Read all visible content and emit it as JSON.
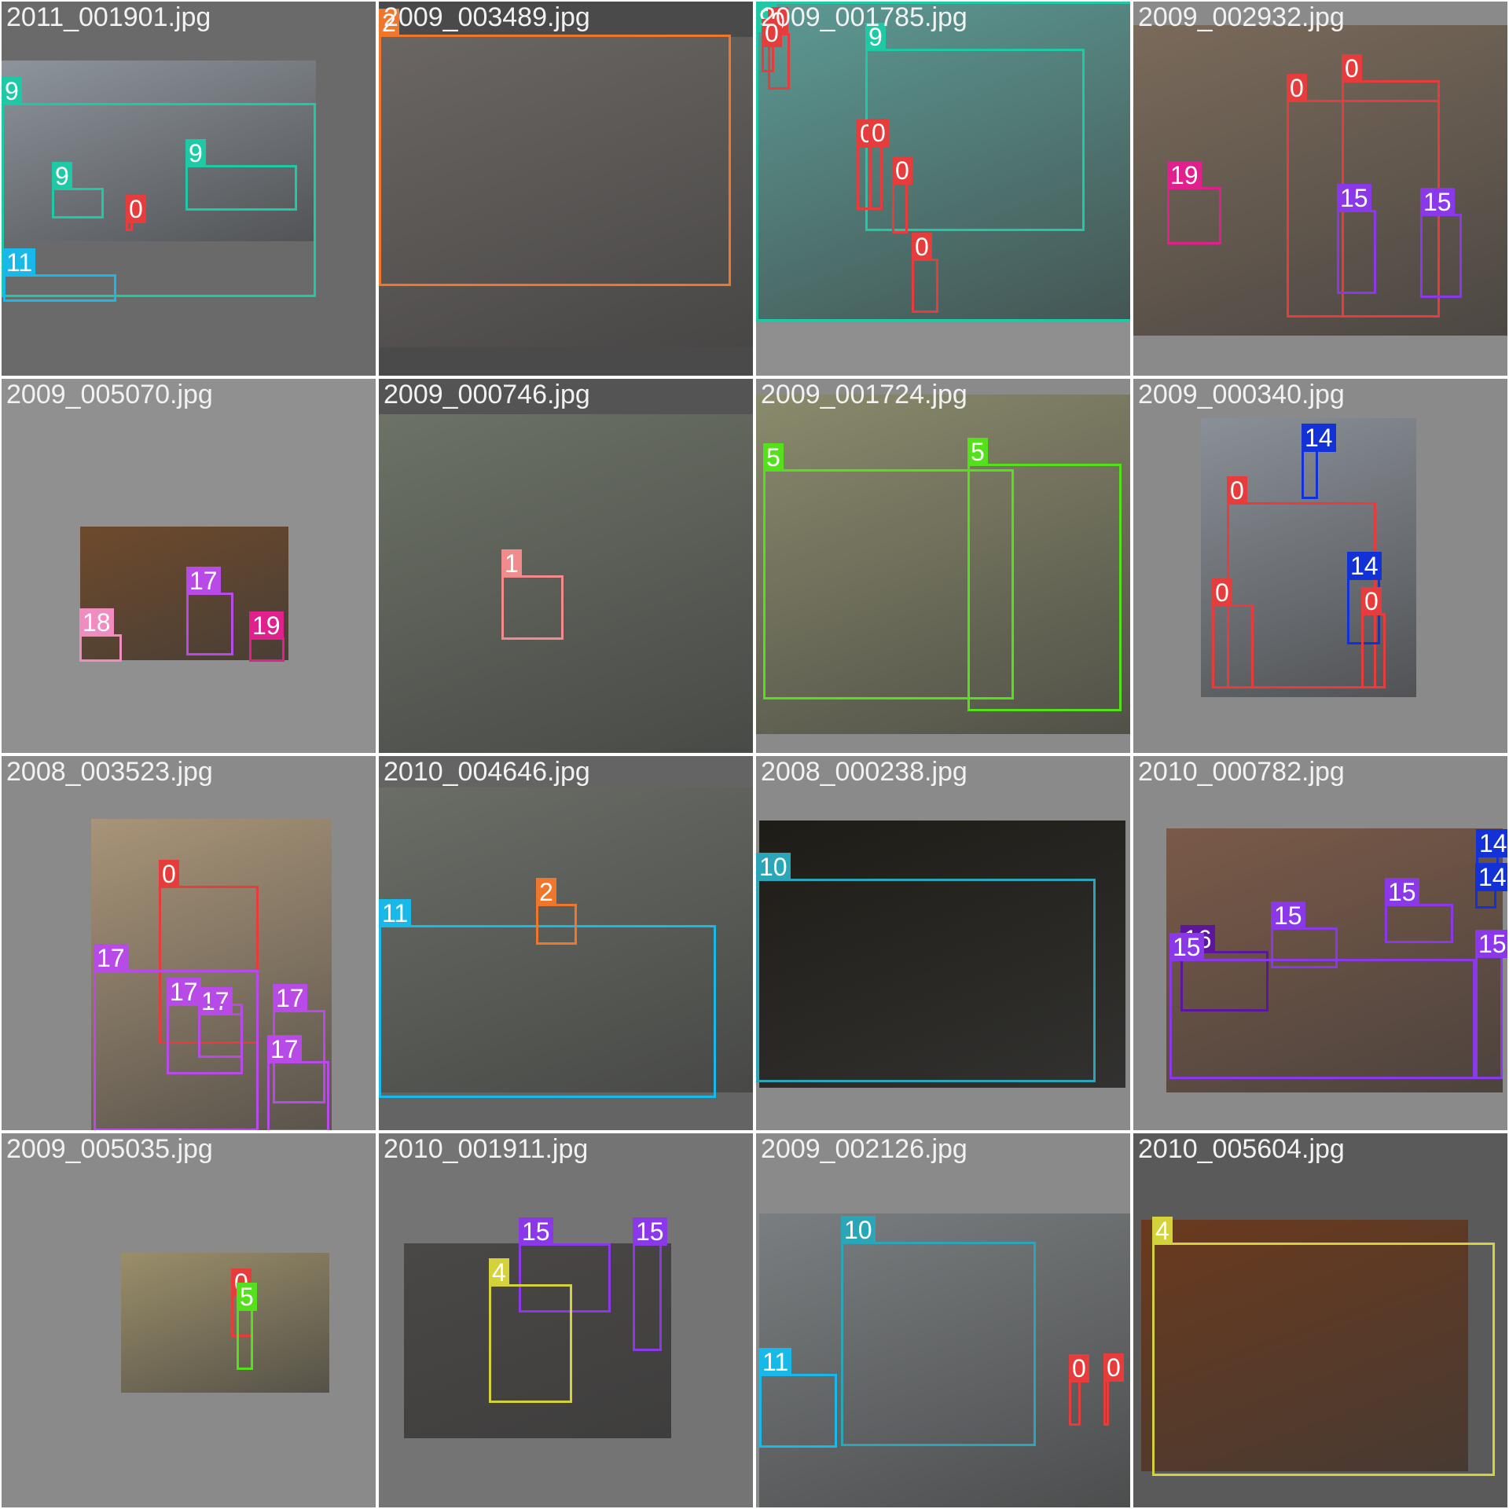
{
  "grid": {
    "rows": 4,
    "cols": 4
  },
  "class_colors": {
    "0": "#e63c3c",
    "1": "#f28b8b",
    "2": "#f0762b",
    "4": "#d4d23a",
    "5": "#55e01c",
    "9": "#1fc9a6",
    "10": "#2aa6b8",
    "11": "#18b8e8",
    "14": "#1232d8",
    "15": "#8a38e8",
    "16": "#5c169c",
    "17": "#b84ae8",
    "18": "#f08cc0",
    "19": "#e0208c"
  },
  "tiles": [
    {
      "filename": "2011_001901.jpg",
      "bg": "#6a6a6a",
      "photo": "#8d949c",
      "boxes": [
        {
          "label": "9"
        },
        {
          "label": "9"
        },
        {
          "label": "9"
        },
        {
          "label": "0"
        },
        {
          "label": "11"
        }
      ]
    },
    {
      "filename": "2009_003489.jpg",
      "bg": "#4a4a4a",
      "photo": "#6b6663",
      "boxes": [
        {
          "label": "2"
        }
      ]
    },
    {
      "filename": "2009_001785.jpg",
      "bg": "#8f8f8f",
      "photo": "#5d9a94",
      "boxes": [
        {
          "label": "9"
        },
        {
          "label": "9"
        },
        {
          "label": "0"
        },
        {
          "label": "0"
        },
        {
          "label": "0"
        },
        {
          "label": "0"
        },
        {
          "label": "0"
        },
        {
          "label": "0"
        }
      ]
    },
    {
      "filename": "2009_002932.jpg",
      "bg": "#8a8a8a",
      "photo": "#7a6a5a",
      "boxes": [
        {
          "label": "0"
        },
        {
          "label": "0"
        },
        {
          "label": "19"
        },
        {
          "label": "15"
        },
        {
          "label": "15"
        }
      ]
    },
    {
      "filename": "2009_005070.jpg",
      "bg": "#909090",
      "photo": "#6e4a2c",
      "boxes": [
        {
          "label": "17"
        },
        {
          "label": "18"
        },
        {
          "label": "19"
        }
      ]
    },
    {
      "filename": "2009_000746.jpg",
      "bg": "#545454",
      "photo": "#6c7266",
      "boxes": [
        {
          "label": "1"
        }
      ]
    },
    {
      "filename": "2009_001724.jpg",
      "bg": "#8a8a8a",
      "photo": "#8a8a6c",
      "boxes": [
        {
          "label": "5"
        },
        {
          "label": "5"
        }
      ]
    },
    {
      "filename": "2009_000340.jpg",
      "bg": "#8a8a8a",
      "photo": "#8a9098",
      "boxes": [
        {
          "label": "14"
        },
        {
          "label": "0"
        },
        {
          "label": "14"
        },
        {
          "label": "0"
        },
        {
          "label": "0"
        }
      ]
    },
    {
      "filename": "2008_003523.jpg",
      "bg": "#8a8a8a",
      "photo": "#a89478",
      "boxes": [
        {
          "label": "0"
        },
        {
          "label": "17"
        },
        {
          "label": "17"
        },
        {
          "label": "17"
        },
        {
          "label": "17"
        },
        {
          "label": "17"
        }
      ]
    },
    {
      "filename": "2010_004646.jpg",
      "bg": "#646464",
      "photo": "#6a6e66",
      "boxes": [
        {
          "label": "11"
        },
        {
          "label": "2"
        }
      ]
    },
    {
      "filename": "2008_000238.jpg",
      "bg": "#8a8a8a",
      "photo": "#1e1c16",
      "boxes": [
        {
          "label": "10"
        }
      ]
    },
    {
      "filename": "2010_000782.jpg",
      "bg": "#8a8a8a",
      "photo": "#7a5a48",
      "boxes": [
        {
          "label": "14"
        },
        {
          "label": "14"
        },
        {
          "label": "15"
        },
        {
          "label": "15"
        },
        {
          "label": "16"
        },
        {
          "label": "15"
        },
        {
          "label": "15"
        }
      ]
    },
    {
      "filename": "2009_005035.jpg",
      "bg": "#8a8a8a",
      "photo": "#9a8e6a",
      "boxes": [
        {
          "label": "0"
        },
        {
          "label": "5"
        }
      ]
    },
    {
      "filename": "2010_001911.jpg",
      "bg": "#747474",
      "photo": "#4a4846",
      "boxes": [
        {
          "label": "15"
        },
        {
          "label": "15"
        },
        {
          "label": "4"
        }
      ]
    },
    {
      "filename": "2009_002126.jpg",
      "bg": "#8a8a8a",
      "photo": "#7a7e80",
      "boxes": [
        {
          "label": "10"
        },
        {
          "label": "11"
        },
        {
          "label": "0"
        },
        {
          "label": "0"
        }
      ]
    },
    {
      "filename": "2010_005604.jpg",
      "bg": "#5a5a5a",
      "photo": "#6a3a1e",
      "boxes": [
        {
          "label": "4"
        }
      ]
    }
  ]
}
